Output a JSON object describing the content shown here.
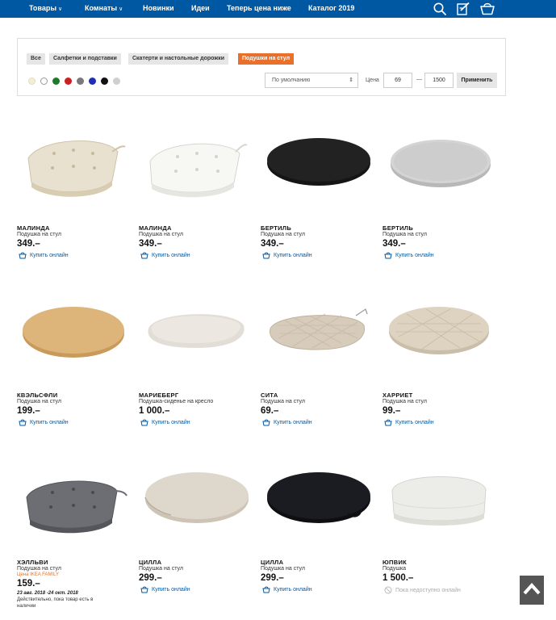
{
  "nav": {
    "items": [
      "Товары",
      "Комнаты",
      "Новинки",
      "Идеи",
      "Теперь цена ниже",
      "Каталог 2019"
    ],
    "chevrons": [
      "chevron-down-icon",
      "chevron-down-icon"
    ],
    "icons": [
      "search-icon",
      "edit-list-icon",
      "basket-icon"
    ],
    "bg_color": "#0058a3"
  },
  "filter": {
    "categories": [
      "Все",
      "Салфетки и подставки",
      "Скатерти и настольные дорожки",
      "Подушки на стул"
    ],
    "active_category": "Подушки на стул",
    "swatches": [
      "#f3efd6",
      "#ffffff",
      "#1e7a2b",
      "#cc1f1f",
      "#7a7a7a",
      "#1f2fb5",
      "#111111",
      "#cfcfcf"
    ],
    "sort": "По умолчанию",
    "price_label": "Цена",
    "price_min": "69",
    "price_sep": "—",
    "price_max": "1500",
    "apply_label": "Применить",
    "accent_color": "#e8702a"
  },
  "products": [
    {
      "name": "МАЛИНДА",
      "desc": "Подушка на стул",
      "price": "349.–",
      "buy": "Купить онлайн"
    },
    {
      "name": "МАЛИНДА",
      "desc": "Подушка на стул",
      "price": "349.–",
      "buy": "Купить онлайн"
    },
    {
      "name": "БЕРТИЛЬ",
      "desc": "Подушка на стул",
      "price": "349.–",
      "buy": "Купить онлайн"
    },
    {
      "name": "БЕРТИЛЬ",
      "desc": "Подушка на стул",
      "price": "349.–",
      "buy": "Купить онлайн"
    },
    {
      "name": "КВЭЛЬСФЛИ",
      "desc": "Подушка на стул",
      "price": "199.–",
      "buy": "Купить онлайн"
    },
    {
      "name": "МАРИЕБЕРГ",
      "desc": "Подушка-сиденье на кресло",
      "price": "1 000.–",
      "buy": "Купить онлайн"
    },
    {
      "name": "СИТА",
      "desc": "Подушка на стул",
      "price": "69.–",
      "buy": "Купить онлайн"
    },
    {
      "name": "ХАРРИЕТ",
      "desc": "Подушка на стул",
      "price": "99.–",
      "buy": "Купить онлайн"
    },
    {
      "name": "ХЭЛЛЬВИ",
      "desc": "Подушка на стул",
      "price": "159.–",
      "promo_label": "Цена IKEA FAMILY",
      "promo_dates": "23 авг. 2018 -24 окт. 2018",
      "promo_note_1": "Действительно, пока товар есть в",
      "promo_note_2": "наличии"
    },
    {
      "name": "ЦИЛЛА",
      "desc": "Подушка на стул",
      "price": "299.–",
      "buy": "Купить онлайн"
    },
    {
      "name": "ЦИЛЛА",
      "desc": "Подушка на стул",
      "price": "299.–",
      "buy": "Купить онлайн"
    },
    {
      "name": "ЮПВИК",
      "desc": "Подушка",
      "price": "1 500.–",
      "buy": "Пока недоступно онлайн",
      "buy_disabled": true
    }
  ],
  "back_to_top_icon": "arrow-up-icon"
}
